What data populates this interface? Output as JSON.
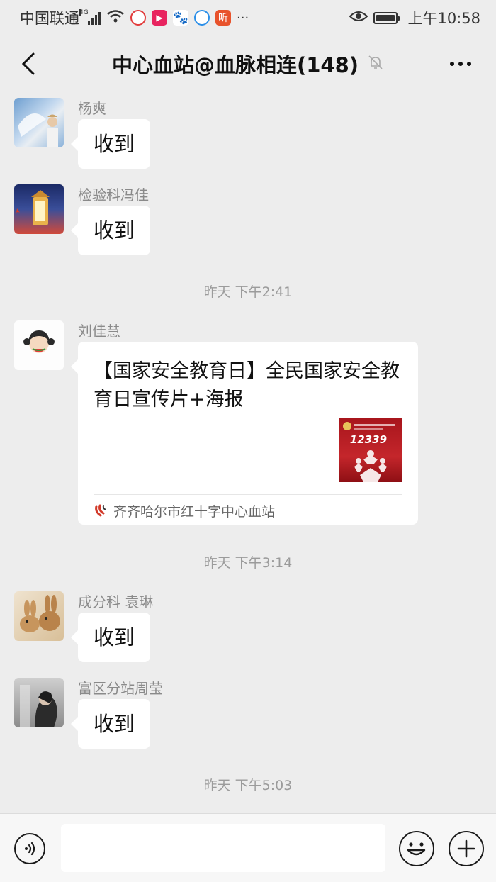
{
  "status_bar": {
    "carrier": "中国联通",
    "network_type": "4G",
    "time": "上午10:58"
  },
  "header": {
    "title": "中心血站@血脉相连(148)"
  },
  "messages": [
    {
      "sender": "杨爽",
      "text": "收到"
    },
    {
      "sender": "检验科冯佳",
      "text": "收到"
    },
    {
      "sender": "成分科 袁琳",
      "text": "收到"
    },
    {
      "sender": "富区分站周莹",
      "text": "收到"
    }
  ],
  "timestamps": [
    "昨天 下午2:41",
    "昨天 下午3:14",
    "昨天 下午5:03"
  ],
  "share_message": {
    "sender": "刘佳慧",
    "title": "【国家安全教育日】全民国家安全教育日宣传片+海报",
    "thumbnail_text": "12339",
    "source": "齐齐哈尔市红十字中心血站"
  },
  "input": {
    "placeholder": ""
  },
  "colors": {
    "background": "#ededed",
    "bubble": "#ffffff",
    "meta_text": "#9b9b9b",
    "thumbnail_red": "#b31b22"
  }
}
